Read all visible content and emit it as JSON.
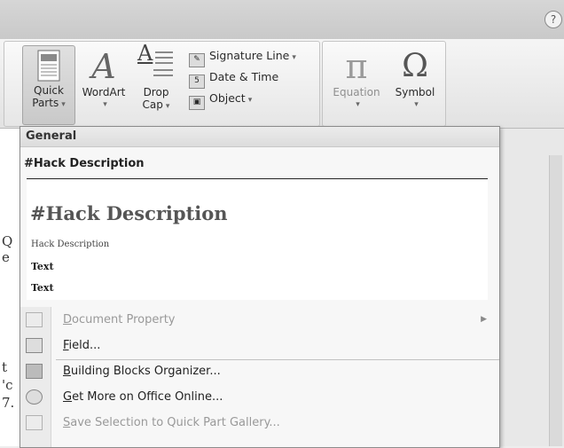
{
  "window": {
    "help_glyph": "?"
  },
  "ribbon": {
    "quick_parts": {
      "line1": "Quick",
      "line2": "Parts",
      "caret": "▾"
    },
    "wordart": {
      "label": "WordArt",
      "caret": "▾"
    },
    "drop_cap": {
      "line1": "Drop",
      "line2": "Cap",
      "caret": "▾"
    },
    "signature_line": "Signature Line",
    "date_time": "Date & Time",
    "object": "Object",
    "equation": {
      "label": "Equation",
      "caret": "▾"
    },
    "symbol": {
      "label": "Symbol",
      "caret": "▾"
    }
  },
  "dropdown": {
    "header": "General",
    "gallery_item_title": "#Hack Description",
    "preview": {
      "heading": "#Hack Description",
      "subtitle": "Hack Description",
      "text1": "Text",
      "text2": "Text"
    },
    "menu": [
      {
        "label": "Document Property",
        "accesskey": "D",
        "rest": "ocument Property",
        "enabled": false,
        "submenu": true
      },
      {
        "label": "Field...",
        "accesskey": "F",
        "rest": "ield...",
        "enabled": true
      },
      {
        "label": "Building Blocks Organizer...",
        "accesskey": "B",
        "rest": "uilding Blocks Organizer...",
        "enabled": true
      },
      {
        "label": "Get More on Office Online...",
        "accesskey": "G",
        "rest": "et More on Office Online...",
        "enabled": true
      },
      {
        "label": "Save Selection to Quick Part Gallery...",
        "accesskey": "S",
        "rest": "ave Selection to Quick Part Gallery...",
        "enabled": false
      }
    ]
  },
  "document_left_fragments": [
    "Q",
    "e",
    "t",
    "'c",
    "7."
  ]
}
